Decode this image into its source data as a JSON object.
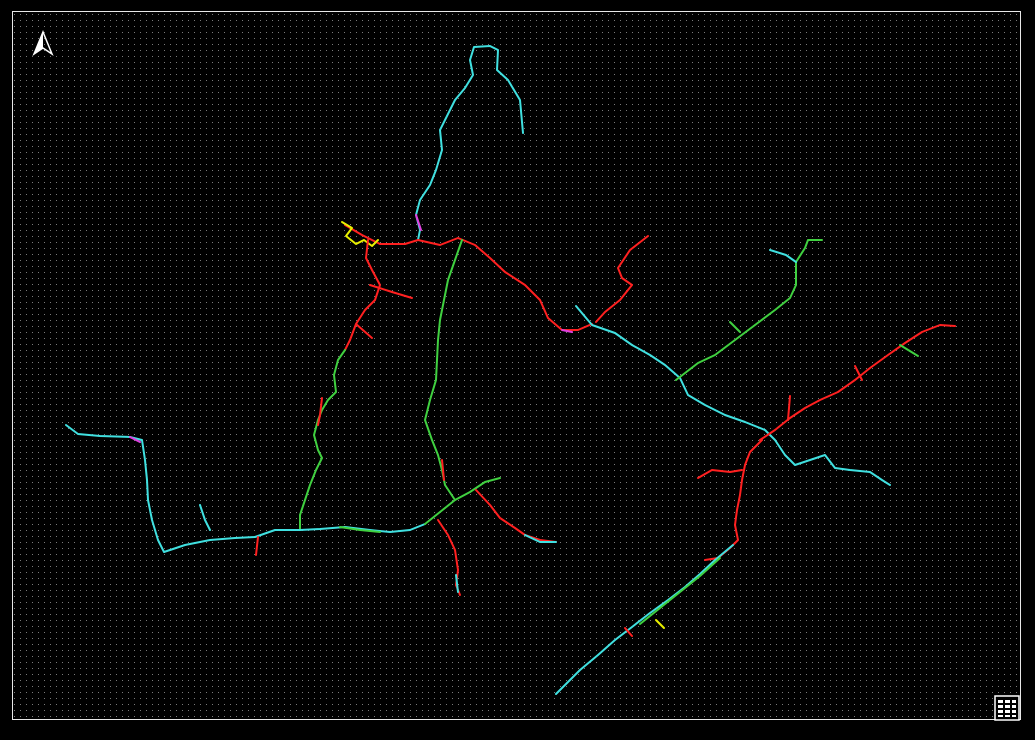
{
  "map": {
    "background": "#000000",
    "grid_dot_color": "#7a7a7a",
    "frame_color": "#e8e8e8",
    "north_arrow_icon": "north-arrow-icon",
    "legend_icon": "legend-grid-icon",
    "network_colors": {
      "red": "#ff2020",
      "cyan": "#40e0e0",
      "green": "#40d040",
      "magenta": "#e040e0",
      "yellow": "#e8f000",
      "blue": "#4060ff"
    }
  }
}
